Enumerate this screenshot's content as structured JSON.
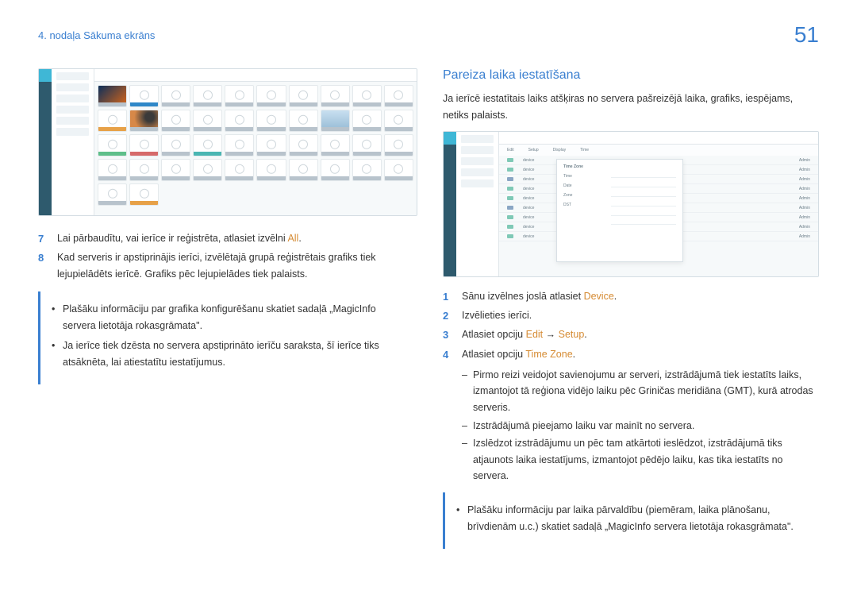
{
  "header": {
    "chapter": "4. nodaļa Sākuma ekrāns",
    "page_number": "51"
  },
  "left_col": {
    "steps": [
      {
        "num": "7",
        "pre": "Lai pārbaudītu, vai ierīce ir reģistrēta, atlasiet izvēlni ",
        "orange": "All",
        "post": "."
      },
      {
        "num": "8",
        "pre": "Kad serveris ir apstiprinājis ierīci, izvēlētajā grupā reģistrētais grafiks tiek lejupielādēts ierīcē. Grafiks pēc lejupielādes tiek palaists.",
        "orange": "",
        "post": ""
      }
    ],
    "info": [
      "Plašāku informāciju par grafika konfigurēšanu skatiet sadaļā „MagicInfo servera lietotāja rokasgrāmata\".",
      "Ja ierīce tiek dzēsta no servera apstiprināto ierīču saraksta, šī ierīce tiks atsāknēta, lai atiestatītu iestatījumus."
    ]
  },
  "right_col": {
    "title": "Pareiza laika iestatīšana",
    "intro": "Ja ierīcē iestatītais laiks atšķiras no servera pašreizējā laika, grafiks, iespējams, netiks palaists.",
    "steps": [
      {
        "num": "1",
        "text_pre": "Sānu izvēlnes joslā atlasiet ",
        "orange1": "Device",
        "mid": "",
        "orange2": "",
        "post": "."
      },
      {
        "num": "2",
        "text_pre": "Izvēlieties ierīci.",
        "orange1": "",
        "mid": "",
        "orange2": "",
        "post": ""
      },
      {
        "num": "3",
        "text_pre": "Atlasiet opciju ",
        "orange1": "Edit",
        "mid": " → ",
        "orange2": "Setup",
        "post": "."
      },
      {
        "num": "4",
        "text_pre": "Atlasiet opciju ",
        "orange1": "Time Zone",
        "mid": "",
        "orange2": "",
        "post": "."
      }
    ],
    "sub_items": [
      "Pirmo reizi veidojot savienojumu ar serveri, izstrādājumā tiek iestatīts laiks, izmantojot tā reģiona vidējo laiku pēc Griničas meridiāna (GMT), kurā atrodas serveris.",
      "Izstrādājumā pieejamo laiku var mainīt no servera.",
      "Izslēdzot izstrādājumu un pēc tam atkārtoti ieslēdzot, izstrādājumā tiks atjaunots laika iestatījums, izmantojot pēdējo laiku, kas tika iestatīts no servera."
    ],
    "info": [
      "Plašāku informāciju par laika pārvaldību (piemēram, laika plānošanu, brīvdienām u.c.) skatiet sadaļā „MagicInfo servera lietotāja rokasgrāmata\"."
    ]
  }
}
